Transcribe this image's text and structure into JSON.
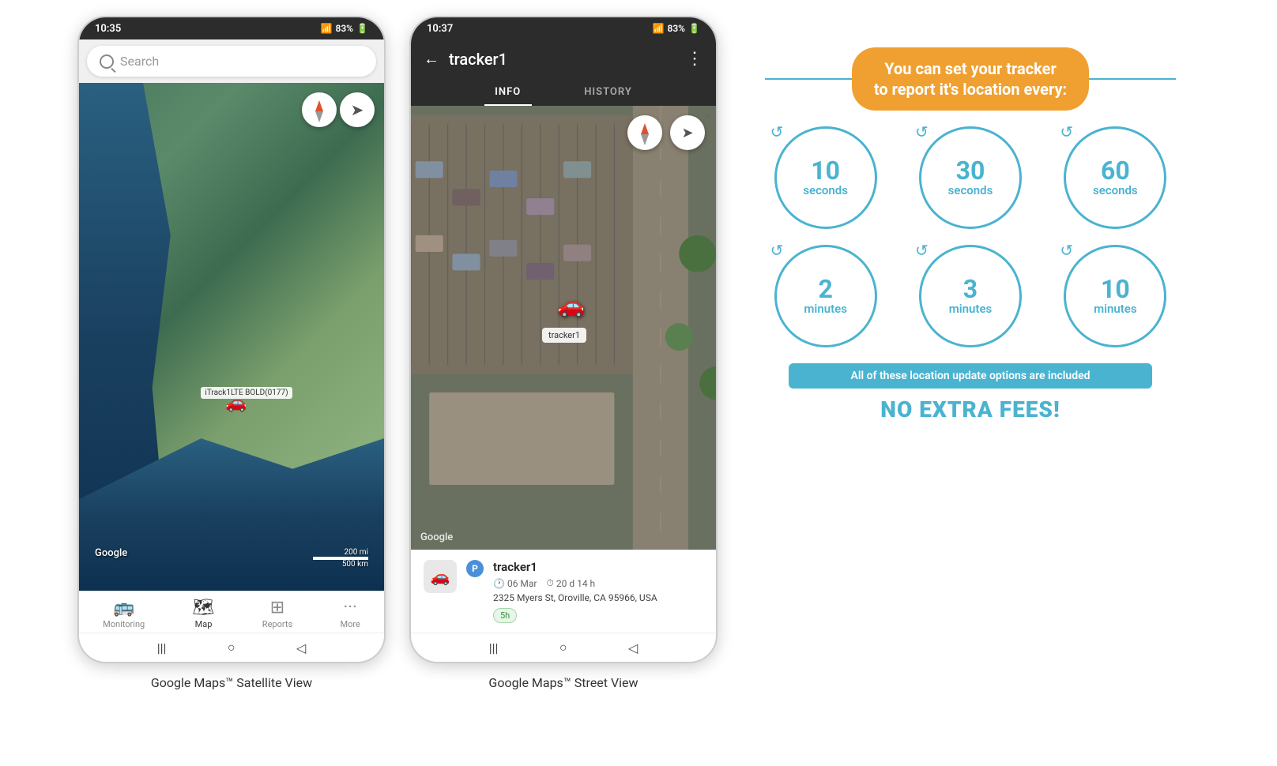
{
  "phone1": {
    "status_bar": {
      "time": "10:35",
      "signal": "▲▲▲",
      "battery": "83%",
      "battery_icon": "🔋"
    },
    "search": {
      "placeholder": "Search"
    },
    "map": {
      "google_label": "Google",
      "scale_200mi": "200 mi",
      "scale_500km": "500 km",
      "tracker_label": "iTrack1LTE BOLD(0177)"
    },
    "bottom_nav": [
      {
        "label": "Monitoring",
        "icon": "🚌",
        "active": false
      },
      {
        "label": "Map",
        "icon": "🗺",
        "active": true
      },
      {
        "label": "Reports",
        "icon": "⊞",
        "active": false
      },
      {
        "label": "More",
        "icon": "•••",
        "active": false
      }
    ]
  },
  "phone2": {
    "status_bar": {
      "time": "10:37",
      "signal": "▲▲▲",
      "battery": "83%"
    },
    "header": {
      "title": "tracker1",
      "back_icon": "←",
      "more_icon": "⋮"
    },
    "tabs": [
      {
        "label": "INFO",
        "active": true
      },
      {
        "label": "HISTORY",
        "active": false
      }
    ],
    "map": {
      "google_label": "Google",
      "tracker_bubble": "tracker1"
    },
    "info_panel": {
      "tracker_name": "tracker1",
      "date": "06 Mar",
      "duration": "20 d 14 h",
      "address": "2325 Myers St, Oroville, CA 95966, USA",
      "time_badge": "5h"
    }
  },
  "captions": {
    "phone1_caption": "Google Maps™ Satellite View",
    "phone2_caption": "Google Maps™ Street View"
  },
  "infographic": {
    "title_line1": "You can set your tracker",
    "title_line2": "to report it's location every:",
    "circles": [
      {
        "number": "10",
        "unit": "seconds"
      },
      {
        "number": "30",
        "unit": "seconds"
      },
      {
        "number": "60",
        "unit": "seconds"
      },
      {
        "number": "2",
        "unit": "minutes"
      },
      {
        "number": "3",
        "unit": "minutes"
      },
      {
        "number": "10",
        "unit": "minutes"
      }
    ],
    "included_text": "All of these location update options are included",
    "no_fees_text": "NO EXTRA FEES!"
  }
}
